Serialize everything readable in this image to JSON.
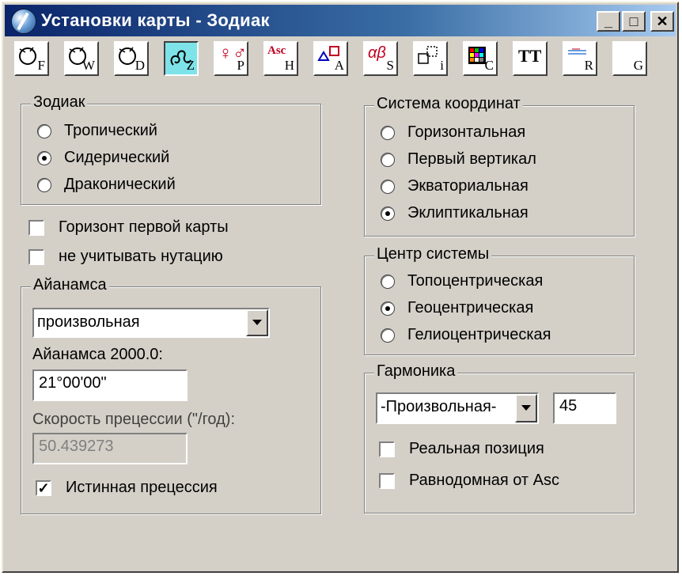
{
  "window": {
    "title": "Установки карты - Зодиак"
  },
  "title_buttons": {
    "minimize": "_",
    "maximize": "□",
    "close": "✕"
  },
  "toolbar": [
    {
      "id": "F",
      "sub": "F",
      "icon": "orbit-circle-icon"
    },
    {
      "id": "W",
      "sub": "W",
      "icon": "orbit-circle-icon"
    },
    {
      "id": "D",
      "sub": "D",
      "icon": "orbit-circle-icon"
    },
    {
      "id": "Z",
      "sub": "Z",
      "icon": "leo-sign-icon",
      "active": true
    },
    {
      "id": "P",
      "sub": "P",
      "icon": "planet-symbols-icon",
      "glyph": "♀♂"
    },
    {
      "id": "H",
      "sub": "H",
      "icon": "ascendant-icon",
      "glyph": "Asc"
    },
    {
      "id": "A",
      "sub": "A",
      "icon": "aspect-shapes-icon"
    },
    {
      "id": "S",
      "sub": "S",
      "icon": "alpha-beta-icon",
      "glyph": "αβ"
    },
    {
      "id": "I",
      "sub": "i",
      "icon": "info-square-icon"
    },
    {
      "id": "C",
      "sub": "C",
      "icon": "color-grid-icon"
    },
    {
      "id": "T",
      "sub": "",
      "icon": "text-tt-icon",
      "glyph": "TT"
    },
    {
      "id": "R",
      "sub": "R",
      "icon": "lines-icon"
    },
    {
      "id": "G",
      "sub": "G",
      "icon": "blank-icon"
    }
  ],
  "zodiac": {
    "label": "Зодиак",
    "options": [
      "Тропический",
      "Сидерический",
      "Драконический"
    ],
    "selected": 1
  },
  "checks": {
    "horizon": {
      "label": "Горизонт первой карты",
      "checked": false
    },
    "nutation": {
      "label": "не учитывать нутацию",
      "checked": false
    }
  },
  "ayanamsa": {
    "label": "Айанамса",
    "select_value": "произвольная",
    "value_label": "Айанамса 2000.0:",
    "value": "21°00'00\"",
    "speed_label": "Скорость прецессии (\"/год):",
    "speed_value": "50.439273",
    "true_precession": {
      "label": "Истинная прецессия",
      "checked": true,
      "mark": "✓"
    }
  },
  "coord_system": {
    "label": "Система координат",
    "options": [
      "Горизонтальная",
      "Первый вертикал",
      "Экваториальная",
      "Эклиптикальная"
    ],
    "selected": 3
  },
  "center": {
    "label": "Центр системы",
    "options": [
      "Топоцентрическая",
      "Геоцентрическая",
      "Гелиоцентрическая"
    ],
    "selected": 1
  },
  "harmonic": {
    "label": "Гармоника",
    "select_value": "-Произвольная-",
    "value": "45",
    "real_position": {
      "label": "Реальная позиция",
      "checked": false
    },
    "equal_from_asc": {
      "label": "Равнодомная от Asc",
      "checked": false
    }
  }
}
